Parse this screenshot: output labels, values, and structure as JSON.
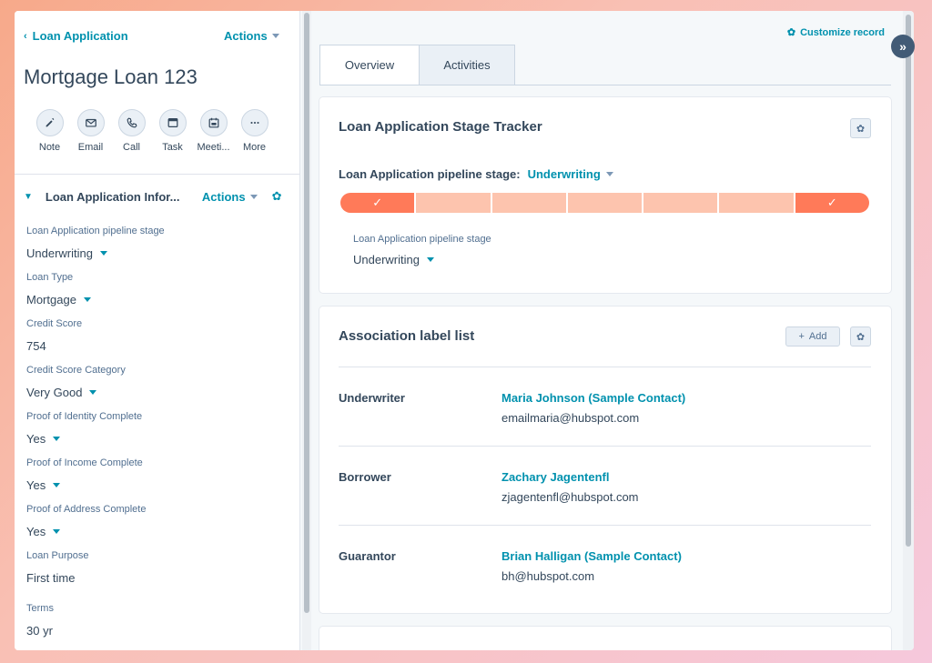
{
  "header": {
    "back_label": "Loan Application",
    "actions_label": "Actions",
    "record_title": "Mortgage Loan 123"
  },
  "quick_actions": [
    {
      "label": "Note",
      "icon": "edit-icon"
    },
    {
      "label": "Email",
      "icon": "email-icon"
    },
    {
      "label": "Call",
      "icon": "phone-icon"
    },
    {
      "label": "Task",
      "icon": "task-icon"
    },
    {
      "label": "Meeti...",
      "icon": "calendar-icon"
    },
    {
      "label": "More",
      "icon": "more-icon"
    }
  ],
  "section": {
    "title": "Loan Application Infor...",
    "actions_label": "Actions"
  },
  "properties": [
    {
      "label": "Loan Application pipeline stage",
      "value": "Underwriting",
      "dropdown": true
    },
    {
      "label": "Loan Type",
      "value": "Mortgage",
      "dropdown": true
    },
    {
      "label": "Credit Score",
      "value": "754",
      "dropdown": false
    },
    {
      "label": "Credit Score Category",
      "value": "Very Good",
      "dropdown": true
    },
    {
      "label": "Proof of Identity Complete",
      "value": "Yes",
      "dropdown": true
    },
    {
      "label": "Proof of Income Complete",
      "value": "Yes",
      "dropdown": true
    },
    {
      "label": "Proof of Address Complete",
      "value": "Yes",
      "dropdown": true
    },
    {
      "label": "Loan Purpose",
      "value": "First time",
      "dropdown": false
    },
    {
      "label": "Terms",
      "value": "30 yr",
      "dropdown": false
    }
  ],
  "right": {
    "customize_label": "Customize record",
    "tabs": [
      {
        "label": "Overview",
        "active": true
      },
      {
        "label": "Activities",
        "active": false
      }
    ],
    "tracker_card": {
      "title": "Loan Application Stage Tracker",
      "pipeline_label": "Loan Application pipeline stage:",
      "pipeline_value": "Underwriting",
      "stages_total": 7,
      "stages_complete": [
        1,
        7
      ],
      "sub_label": "Loan Application pipeline stage",
      "sub_value": "Underwriting"
    },
    "assoc_card": {
      "title": "Association label list",
      "add_label": "Add",
      "rows": [
        {
          "role": "Underwriter",
          "name": "Maria Johnson (Sample Contact)",
          "email": "emailmaria@hubspot.com"
        },
        {
          "role": "Borrower",
          "name": "Zachary Jagentenfl",
          "email": "zjagentenfl@hubspot.com"
        },
        {
          "role": "Guarantor",
          "name": "Brian Halligan (Sample Contact)",
          "email": "bh@hubspot.com"
        }
      ]
    }
  },
  "colors": {
    "accent": "#0091ae",
    "tracker_complete": "#ff7a59",
    "tracker_pending": "#fdc4ae"
  }
}
